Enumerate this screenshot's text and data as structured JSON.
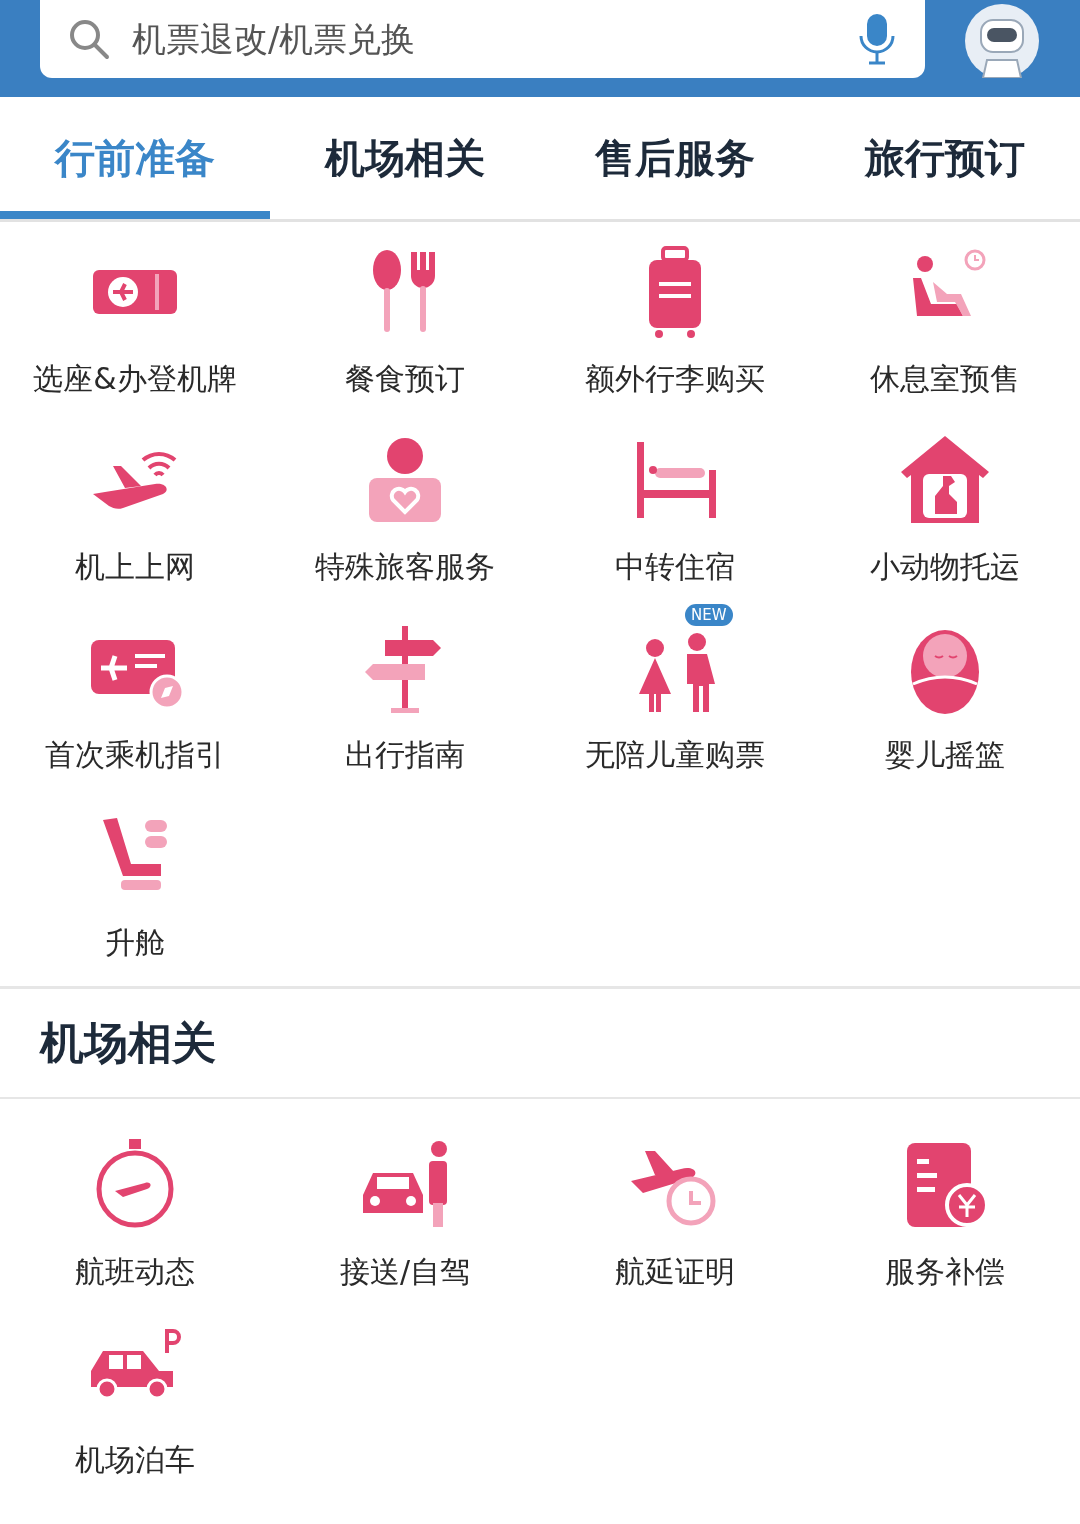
{
  "search": {
    "placeholder": "机票退改/机票兑换"
  },
  "tabs": [
    {
      "label": "行前准备",
      "selected": true
    },
    {
      "label": "机场相关",
      "selected": false
    },
    {
      "label": "售后服务",
      "selected": false
    },
    {
      "label": "旅行预订",
      "selected": false
    }
  ],
  "sections": [
    {
      "items": [
        {
          "label": "选座&办登机牌"
        },
        {
          "label": "餐食预订"
        },
        {
          "label": "额外行李购买"
        },
        {
          "label": "休息室预售"
        },
        {
          "label": "机上上网"
        },
        {
          "label": "特殊旅客服务"
        },
        {
          "label": "中转住宿"
        },
        {
          "label": "小动物托运"
        },
        {
          "label": "首次乘机指引"
        },
        {
          "label": "出行指南"
        },
        {
          "label": "无陪儿童购票",
          "badge": "NEW"
        },
        {
          "label": "婴儿摇篮"
        },
        {
          "label": "升舱"
        }
      ]
    },
    {
      "title": "机场相关",
      "items": [
        {
          "label": "航班动态"
        },
        {
          "label": "接送/自驾"
        },
        {
          "label": "航延证明"
        },
        {
          "label": "服务补偿"
        },
        {
          "label": "机场泊车"
        }
      ]
    }
  ]
}
